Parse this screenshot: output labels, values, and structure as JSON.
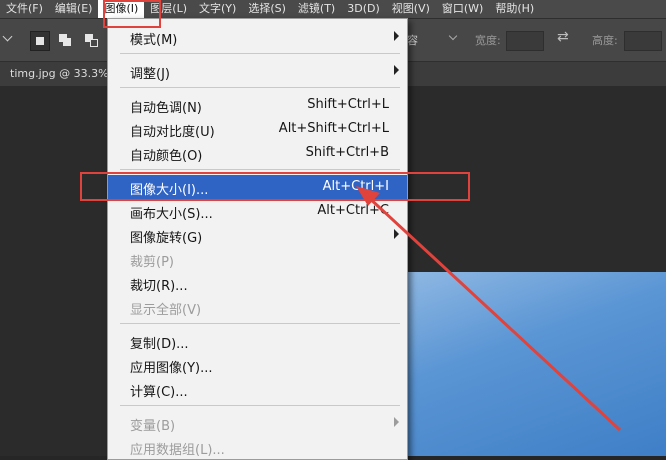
{
  "menubar": {
    "items": [
      {
        "label": "文件(F)",
        "active": false
      },
      {
        "label": "编辑(E)",
        "active": false
      },
      {
        "label": "图像(I)",
        "active": true
      },
      {
        "label": "图层(L)",
        "active": false
      },
      {
        "label": "文字(Y)",
        "active": false
      },
      {
        "label": "选择(S)",
        "active": false
      },
      {
        "label": "滤镜(T)",
        "active": false
      },
      {
        "label": "3D(D)",
        "active": false
      },
      {
        "label": "视图(V)",
        "active": false
      },
      {
        "label": "窗口(W)",
        "active": false
      },
      {
        "label": "帮助(H)",
        "active": false
      }
    ]
  },
  "options_bar": {
    "partial_text": "容",
    "width_label": "宽度:",
    "height_label": "高度:",
    "swap_icon": "swap-arrows-icon"
  },
  "document": {
    "tab_label": "timg.jpg @ 33.3%"
  },
  "image_menu": {
    "rows": [
      {
        "label": "模式(M)",
        "shortcut": "",
        "submenu": true,
        "disabled": false,
        "highlighted": false
      },
      {
        "separator": true
      },
      {
        "label": "调整(J)",
        "shortcut": "",
        "submenu": true,
        "disabled": false,
        "highlighted": false
      },
      {
        "separator": true
      },
      {
        "label": "自动色调(N)",
        "shortcut": "Shift+Ctrl+L",
        "submenu": false,
        "disabled": false,
        "highlighted": false
      },
      {
        "label": "自动对比度(U)",
        "shortcut": "Alt+Shift+Ctrl+L",
        "submenu": false,
        "disabled": false,
        "highlighted": false
      },
      {
        "label": "自动颜色(O)",
        "shortcut": "Shift+Ctrl+B",
        "submenu": false,
        "disabled": false,
        "highlighted": false
      },
      {
        "separator": true
      },
      {
        "label": "图像大小(I)...",
        "shortcut": "Alt+Ctrl+I",
        "submenu": false,
        "disabled": false,
        "highlighted": true
      },
      {
        "label": "画布大小(S)...",
        "shortcut": "Alt+Ctrl+C",
        "submenu": false,
        "disabled": false,
        "highlighted": false
      },
      {
        "label": "图像旋转(G)",
        "shortcut": "",
        "submenu": true,
        "disabled": false,
        "highlighted": false
      },
      {
        "label": "裁剪(P)",
        "shortcut": "",
        "submenu": false,
        "disabled": true,
        "highlighted": false
      },
      {
        "label": "裁切(R)...",
        "shortcut": "",
        "submenu": false,
        "disabled": false,
        "highlighted": false
      },
      {
        "label": "显示全部(V)",
        "shortcut": "",
        "submenu": false,
        "disabled": true,
        "highlighted": false
      },
      {
        "separator": true
      },
      {
        "label": "复制(D)...",
        "shortcut": "",
        "submenu": false,
        "disabled": false,
        "highlighted": false
      },
      {
        "label": "应用图像(Y)...",
        "shortcut": "",
        "submenu": false,
        "disabled": false,
        "highlighted": false
      },
      {
        "label": "计算(C)...",
        "shortcut": "",
        "submenu": false,
        "disabled": false,
        "highlighted": false
      },
      {
        "separator": true
      },
      {
        "label": "变量(B)",
        "shortcut": "",
        "submenu": true,
        "disabled": true,
        "highlighted": false
      },
      {
        "label": "应用数据组(L)...",
        "shortcut": "",
        "submenu": false,
        "disabled": true,
        "highlighted": false
      }
    ]
  },
  "colors": {
    "highlight": "#2f63c4",
    "annotation_red": "#e0423c",
    "menu_bg": "#f2f2f2"
  }
}
